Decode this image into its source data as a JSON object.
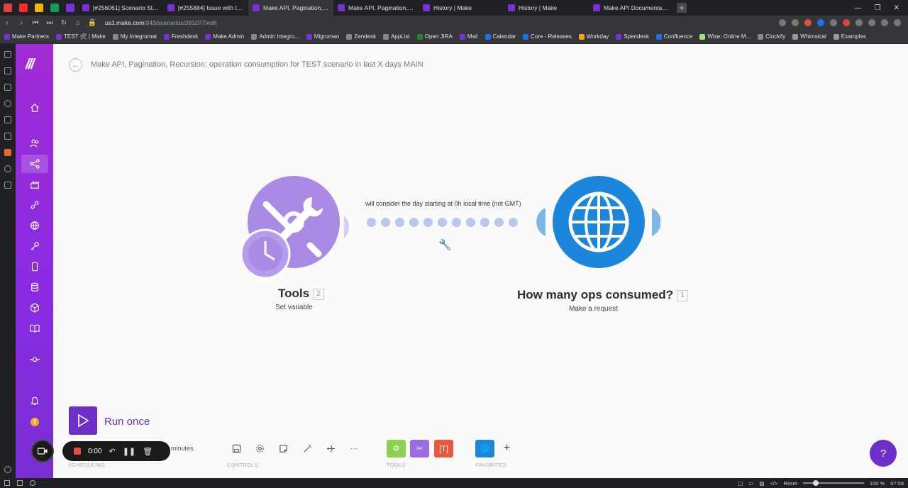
{
  "browser": {
    "tabs": [
      {
        "label": "[#256061] Scenario Stoppe",
        "color": "#7b2fd6",
        "active": false
      },
      {
        "label": "[#255884] Issue with the pa",
        "color": "#7b2fd6",
        "active": false
      },
      {
        "label": "Make API, Pagination, Recu",
        "color": "#7b2fd6",
        "active": true
      },
      {
        "label": "Make API, Pagination, Recu",
        "color": "#7b2fd6",
        "active": false
      },
      {
        "label": "History | Make",
        "color": "#7b2fd6",
        "active": false
      },
      {
        "label": "History | Make",
        "color": "#7b2fd6",
        "active": false
      },
      {
        "label": "Make API Documentation",
        "color": "#7b2fd6",
        "active": false
      }
    ],
    "new_tab": "+",
    "url_domain": "us1.make.com",
    "url_path": "/343/scenarios/381077/edit",
    "bookmarks": [
      {
        "label": "Make Partners",
        "color": "#7b2fd6"
      },
      {
        "label": "TEST 🛠 | Make",
        "color": "#7b2fd6"
      },
      {
        "label": "My Integromat",
        "color": "#333333"
      },
      {
        "label": "Freshdesk",
        "color": "#7b2fd6"
      },
      {
        "label": "Make Admin",
        "color": "#7b2fd6"
      },
      {
        "label": "Admin Integro...",
        "color": "#555555"
      },
      {
        "label": "Migroman",
        "color": "#7b2fd6"
      },
      {
        "label": "Zendesk",
        "color": "#555555"
      },
      {
        "label": "AppList",
        "color": "#555555"
      },
      {
        "label": "Open JIRA",
        "color": "#2e7d32"
      },
      {
        "label": "Mail",
        "color": "#7b2fd6"
      },
      {
        "label": "Calendar",
        "color": "#1a73e8"
      },
      {
        "label": "Core - Releases",
        "color": "#1a73e8"
      },
      {
        "label": "Workday",
        "color": "#f5a623"
      },
      {
        "label": "Spendesk",
        "color": "#7b2fd6"
      },
      {
        "label": "Confluence",
        "color": "#1a73e8"
      },
      {
        "label": "Wise: Online M...",
        "color": "#9fe870"
      },
      {
        "label": "Clockify",
        "color": "#555555"
      },
      {
        "label": "Whimsical",
        "color": "#777777"
      },
      {
        "label": "Examples",
        "color": "#777777"
      }
    ]
  },
  "scenario": {
    "title": "Make API, Pagination, Recursion: operation consumption for TEST scenario in last X days MAIN",
    "modules": [
      {
        "name": "Tools",
        "badge": "2",
        "subtitle": "Set variable",
        "color": "#a98be6"
      },
      {
        "name": "How many ops consumed?",
        "badge": "1",
        "subtitle": "Make a request",
        "color": "#1c86dc"
      }
    ],
    "link_note": "will consider the day starting at 0h local time (not GMT)"
  },
  "toolbar": {
    "run_once": "Run once",
    "schedule_text": "minutes.",
    "sections": {
      "scheduling": "SCHEDULING",
      "controls": "CONTROLS",
      "tools": "TOOLS",
      "favorites": "FAVORITES"
    },
    "more_label": "···",
    "add_label": "+"
  },
  "recorder": {
    "time": "0:00"
  },
  "statusbar": {
    "reset": "Reset",
    "zoom": "100 %",
    "clock": "07:58"
  },
  "colors": {
    "brand_purple": "#6e2ec9",
    "sidebar_top": "#a22bd6",
    "tools_green": "#8fd14f",
    "tools_purple": "#9b6ce0",
    "tools_red": "#e8573f",
    "http_blue": "#1c86dc"
  }
}
